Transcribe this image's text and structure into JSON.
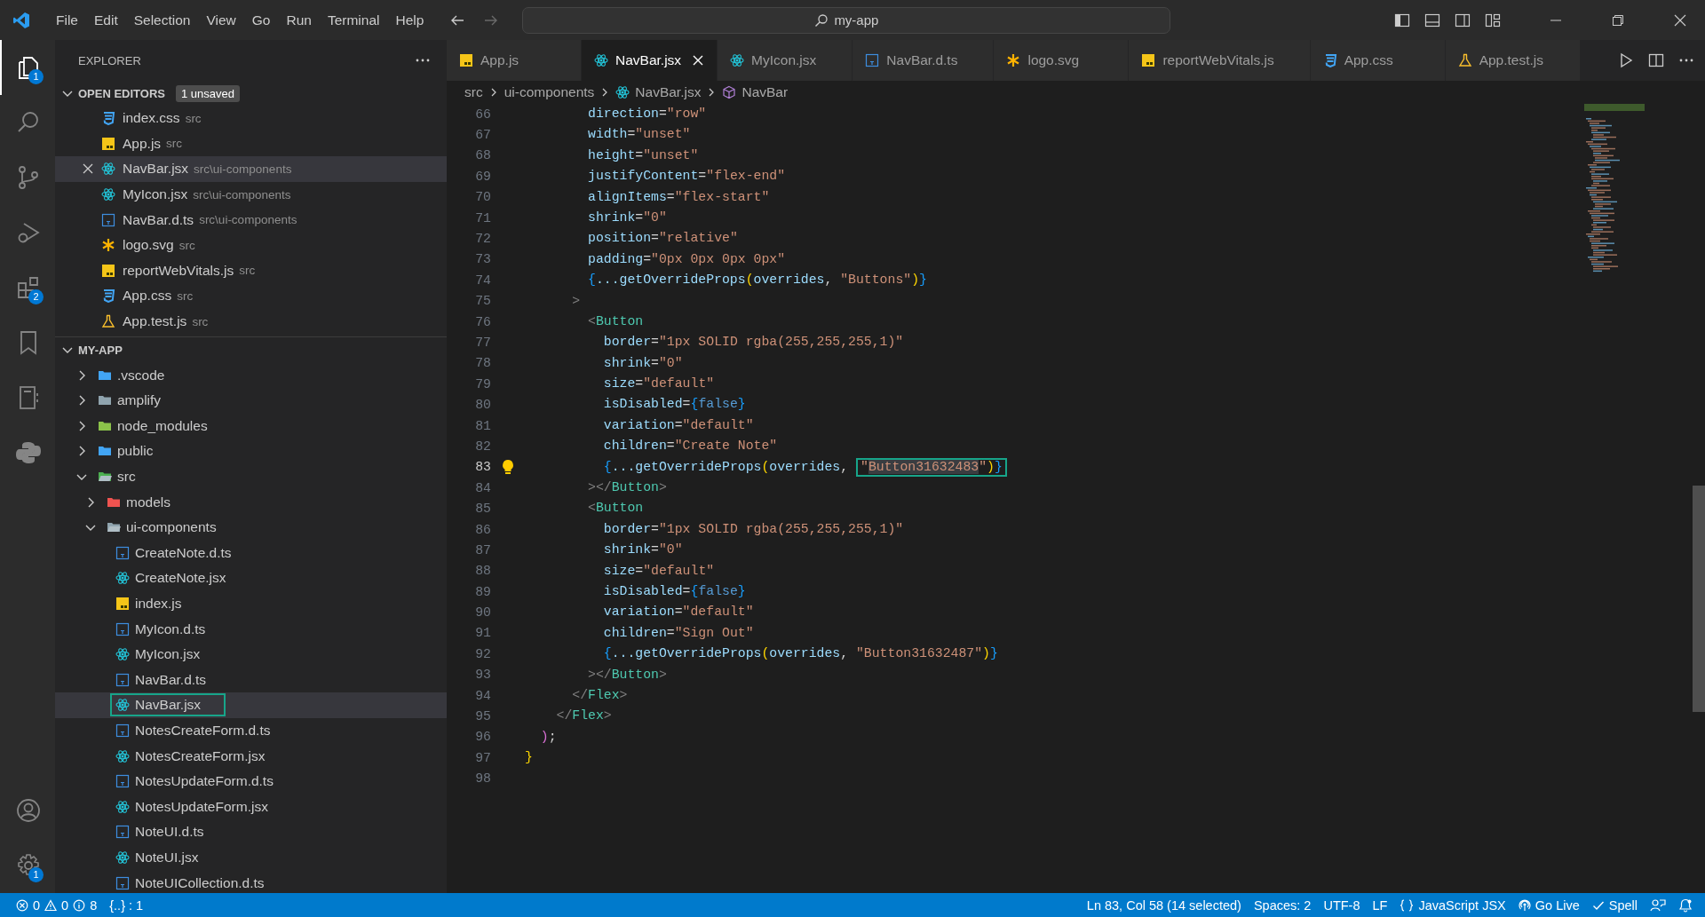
{
  "title_bar": {
    "menu": [
      "File",
      "Edit",
      "Selection",
      "View",
      "Go",
      "Run",
      "Terminal",
      "Help"
    ],
    "search": "my-app"
  },
  "activity_bar": {
    "items": [
      {
        "kind": "files",
        "badge": "1",
        "selected": true
      },
      {
        "kind": "search",
        "selected": false
      },
      {
        "kind": "source-control",
        "selected": false
      },
      {
        "kind": "run",
        "selected": false
      },
      {
        "kind": "extensions",
        "badge": "2",
        "selected": false
      },
      {
        "kind": "bookmark",
        "selected": false
      },
      {
        "kind": "notebook",
        "selected": false
      },
      {
        "kind": "python",
        "selected": false
      }
    ],
    "bottom": [
      {
        "kind": "account"
      },
      {
        "kind": "gear",
        "badge": "1"
      }
    ]
  },
  "sidebar": {
    "title": "EXPLORER",
    "open_editors": {
      "title": "OPEN EDITORS",
      "expanded": true,
      "badge": "1 unsaved",
      "items": [
        {
          "kind": "css",
          "name": "index.css",
          "path": "src",
          "selected": false
        },
        {
          "kind": "js",
          "name": "App.js",
          "path": "src",
          "selected": false
        },
        {
          "kind": "react",
          "name": "NavBar.jsx",
          "path": "src\\ui-components",
          "selected": true
        },
        {
          "kind": "react",
          "name": "MyIcon.jsx",
          "path": "src\\ui-components",
          "selected": false
        },
        {
          "kind": "ts",
          "name": "NavBar.d.ts",
          "path": "src\\ui-components",
          "selected": false
        },
        {
          "kind": "svg",
          "name": "logo.svg",
          "path": "src",
          "selected": false
        },
        {
          "kind": "js",
          "name": "reportWebVitals.js",
          "path": "src",
          "selected": false
        },
        {
          "kind": "css",
          "name": "App.css",
          "path": "src",
          "selected": false
        },
        {
          "kind": "test",
          "name": "App.test.js",
          "path": "src",
          "selected": false
        }
      ]
    },
    "project": {
      "title": "MY-APP",
      "expanded": true,
      "tree": [
        {
          "kind": "folder-vscode",
          "name": ".vscode",
          "expanded": false,
          "selected": false
        },
        {
          "kind": "folder",
          "name": "amplify",
          "expanded": false,
          "selected": false
        },
        {
          "kind": "folder-node",
          "name": "node_modules",
          "expanded": false,
          "selected": false
        },
        {
          "kind": "folder-public",
          "name": "public",
          "expanded": false,
          "selected": false
        },
        {
          "kind": "folder-src",
          "name": "src",
          "expanded": true,
          "selected": false,
          "children": [
            {
              "kind": "folder-models",
              "name": "models",
              "expanded": false,
              "selected": false
            },
            {
              "kind": "folder",
              "name": "ui-components",
              "expanded": true,
              "selected": false,
              "children": [
                {
                  "kind": "ts",
                  "name": "CreateNote.d.ts",
                  "selected": false
                },
                {
                  "kind": "react",
                  "name": "CreateNote.jsx",
                  "selected": false
                },
                {
                  "kind": "js",
                  "name": "index.js",
                  "selected": false
                },
                {
                  "kind": "ts",
                  "name": "MyIcon.d.ts",
                  "selected": false
                },
                {
                  "kind": "react",
                  "name": "MyIcon.jsx",
                  "selected": false
                },
                {
                  "kind": "ts",
                  "name": "NavBar.d.ts",
                  "selected": false
                },
                {
                  "kind": "react",
                  "name": "NavBar.jsx",
                  "selected": true
                },
                {
                  "kind": "ts",
                  "name": "NotesCreateForm.d.ts",
                  "selected": false
                },
                {
                  "kind": "react",
                  "name": "NotesCreateForm.jsx",
                  "selected": false
                },
                {
                  "kind": "ts",
                  "name": "NotesUpdateForm.d.ts",
                  "selected": false
                },
                {
                  "kind": "react",
                  "name": "NotesUpdateForm.jsx",
                  "selected": false
                },
                {
                  "kind": "ts",
                  "name": "NoteUI.d.ts",
                  "selected": false
                },
                {
                  "kind": "react",
                  "name": "NoteUI.jsx",
                  "selected": false
                },
                {
                  "kind": "ts",
                  "name": "NoteUICollection.d.ts",
                  "selected": false
                }
              ]
            }
          ]
        }
      ]
    }
  },
  "tabs": [
    {
      "kind": "js",
      "label": "App.js",
      "selected": false
    },
    {
      "kind": "react",
      "label": "NavBar.jsx",
      "selected": true
    },
    {
      "kind": "react",
      "label": "MyIcon.jsx",
      "selected": false
    },
    {
      "kind": "ts",
      "label": "NavBar.d.ts",
      "selected": false
    },
    {
      "kind": "svg",
      "label": "logo.svg",
      "selected": false
    },
    {
      "kind": "js",
      "label": "reportWebVitals.js",
      "selected": false
    },
    {
      "kind": "css",
      "label": "App.css",
      "selected": false
    },
    {
      "kind": "test",
      "label": "App.test.js",
      "selected": false
    }
  ],
  "breadcrumbs": [
    {
      "kind": "folder",
      "label": "src"
    },
    {
      "kind": "folder",
      "label": "ui-components"
    },
    {
      "kind": "react",
      "label": "NavBar.jsx"
    },
    {
      "kind": "component",
      "label": "NavBar"
    }
  ],
  "editor": {
    "lines": [
      {
        "number": "66",
        "current": false,
        "tokens": [
          {
            "kind": "attr",
            "text": "        direction"
          },
          {
            "kind": "op",
            "text": "="
          },
          {
            "kind": "str",
            "text": "\"row\""
          }
        ]
      },
      {
        "number": "67",
        "current": false,
        "tokens": [
          {
            "kind": "attr",
            "text": "        width"
          },
          {
            "kind": "op",
            "text": "="
          },
          {
            "kind": "str",
            "text": "\"unset\""
          }
        ]
      },
      {
        "number": "68",
        "current": false,
        "tokens": [
          {
            "kind": "attr",
            "text": "        height"
          },
          {
            "kind": "op",
            "text": "="
          },
          {
            "kind": "str",
            "text": "\"unset\""
          }
        ]
      },
      {
        "number": "69",
        "current": false,
        "tokens": [
          {
            "kind": "attr",
            "text": "        justifyContent"
          },
          {
            "kind": "op",
            "text": "="
          },
          {
            "kind": "str",
            "text": "\"flex-end\""
          }
        ]
      },
      {
        "number": "70",
        "current": false,
        "tokens": [
          {
            "kind": "attr",
            "text": "        alignItems"
          },
          {
            "kind": "op",
            "text": "="
          },
          {
            "kind": "str",
            "text": "\"flex-start\""
          }
        ]
      },
      {
        "number": "71",
        "current": false,
        "tokens": [
          {
            "kind": "attr",
            "text": "        shrink"
          },
          {
            "kind": "op",
            "text": "="
          },
          {
            "kind": "str",
            "text": "\"0\""
          }
        ]
      },
      {
        "number": "72",
        "current": false,
        "tokens": [
          {
            "kind": "attr",
            "text": "        position"
          },
          {
            "kind": "op",
            "text": "="
          },
          {
            "kind": "str",
            "text": "\"relative\""
          }
        ]
      },
      {
        "number": "73",
        "current": false,
        "tokens": [
          {
            "kind": "attr",
            "text": "        padding"
          },
          {
            "kind": "op",
            "text": "="
          },
          {
            "kind": "str",
            "text": "\"0px 0px 0px 0px\""
          }
        ]
      },
      {
        "number": "74",
        "current": false,
        "tokens": [
          {
            "kind": "b3",
            "text": "        {"
          },
          {
            "kind": "attr",
            "text": "...getOverrideProps"
          },
          {
            "kind": "b1",
            "text": "("
          },
          {
            "kind": "attr",
            "text": "overrides"
          },
          {
            "kind": "op",
            "text": ", "
          },
          {
            "kind": "str",
            "text": "\"Buttons\""
          },
          {
            "kind": "b1",
            "text": ")"
          },
          {
            "kind": "b3",
            "text": "}"
          }
        ]
      },
      {
        "number": "75",
        "current": false,
        "tokens": [
          {
            "kind": "punc",
            "text": "      >"
          }
        ]
      },
      {
        "number": "76",
        "current": false,
        "tokens": [
          {
            "kind": "punc",
            "text": "        <"
          },
          {
            "kind": "tag",
            "text": "Button"
          }
        ]
      },
      {
        "number": "77",
        "current": false,
        "tokens": [
          {
            "kind": "attr",
            "text": "          border"
          },
          {
            "kind": "op",
            "text": "="
          },
          {
            "kind": "str",
            "text": "\"1px SOLID rgba(255,255,255,1)\""
          }
        ]
      },
      {
        "number": "78",
        "current": false,
        "tokens": [
          {
            "kind": "attr",
            "text": "          shrink"
          },
          {
            "kind": "op",
            "text": "="
          },
          {
            "kind": "str",
            "text": "\"0\""
          }
        ]
      },
      {
        "number": "79",
        "current": false,
        "tokens": [
          {
            "kind": "attr",
            "text": "          size"
          },
          {
            "kind": "op",
            "text": "="
          },
          {
            "kind": "str",
            "text": "\"default\""
          }
        ]
      },
      {
        "number": "80",
        "current": false,
        "tokens": [
          {
            "kind": "attr",
            "text": "          isDisabled"
          },
          {
            "kind": "op",
            "text": "="
          },
          {
            "kind": "b3",
            "text": "{"
          },
          {
            "kind": "kw",
            "text": "false"
          },
          {
            "kind": "b3",
            "text": "}"
          }
        ]
      },
      {
        "number": "81",
        "current": false,
        "tokens": [
          {
            "kind": "attr",
            "text": "          variation"
          },
          {
            "kind": "op",
            "text": "="
          },
          {
            "kind": "str",
            "text": "\"default\""
          }
        ]
      },
      {
        "number": "82",
        "current": false,
        "tokens": [
          {
            "kind": "attr",
            "text": "          children"
          },
          {
            "kind": "op",
            "text": "="
          },
          {
            "kind": "str",
            "text": "\"Create Note\""
          }
        ]
      },
      {
        "number": "83",
        "current": true,
        "tokens": [
          {
            "kind": "b3",
            "text": "          {"
          },
          {
            "kind": "attr",
            "text": "...getOverrideProps"
          },
          {
            "kind": "b1",
            "text": "("
          },
          {
            "kind": "attr",
            "text": "overrides"
          },
          {
            "kind": "op",
            "text": ", "
          },
          {
            "kind": "box",
            "parts": [
              {
                "kind": "str",
                "text": "\""
              },
              {
                "kind": "sel",
                "text": "Button31632483"
              },
              {
                "kind": "str",
                "text": "\""
              },
              {
                "kind": "b1",
                "text": ")"
              },
              {
                "kind": "b3",
                "text": "}"
              }
            ]
          }
        ]
      },
      {
        "number": "84",
        "current": false,
        "tokens": [
          {
            "kind": "punc",
            "text": "        ></"
          },
          {
            "kind": "tag",
            "text": "Button"
          },
          {
            "kind": "punc",
            "text": ">"
          }
        ]
      },
      {
        "number": "85",
        "current": false,
        "tokens": [
          {
            "kind": "punc",
            "text": "        <"
          },
          {
            "kind": "tag",
            "text": "Button"
          }
        ]
      },
      {
        "number": "86",
        "current": false,
        "tokens": [
          {
            "kind": "attr",
            "text": "          border"
          },
          {
            "kind": "op",
            "text": "="
          },
          {
            "kind": "str",
            "text": "\"1px SOLID rgba(255,255,255,1)\""
          }
        ]
      },
      {
        "number": "87",
        "current": false,
        "tokens": [
          {
            "kind": "attr",
            "text": "          shrink"
          },
          {
            "kind": "op",
            "text": "="
          },
          {
            "kind": "str",
            "text": "\"0\""
          }
        ]
      },
      {
        "number": "88",
        "current": false,
        "tokens": [
          {
            "kind": "attr",
            "text": "          size"
          },
          {
            "kind": "op",
            "text": "="
          },
          {
            "kind": "str",
            "text": "\"default\""
          }
        ]
      },
      {
        "number": "89",
        "current": false,
        "tokens": [
          {
            "kind": "attr",
            "text": "          isDisabled"
          },
          {
            "kind": "op",
            "text": "="
          },
          {
            "kind": "b3",
            "text": "{"
          },
          {
            "kind": "kw",
            "text": "false"
          },
          {
            "kind": "b3",
            "text": "}"
          }
        ]
      },
      {
        "number": "90",
        "current": false,
        "tokens": [
          {
            "kind": "attr",
            "text": "          variation"
          },
          {
            "kind": "op",
            "text": "="
          },
          {
            "kind": "str",
            "text": "\"default\""
          }
        ]
      },
      {
        "number": "91",
        "current": false,
        "tokens": [
          {
            "kind": "attr",
            "text": "          children"
          },
          {
            "kind": "op",
            "text": "="
          },
          {
            "kind": "str",
            "text": "\"Sign Out\""
          }
        ]
      },
      {
        "number": "92",
        "current": false,
        "tokens": [
          {
            "kind": "b3",
            "text": "          {"
          },
          {
            "kind": "attr",
            "text": "...getOverrideProps"
          },
          {
            "kind": "b1",
            "text": "("
          },
          {
            "kind": "attr",
            "text": "overrides"
          },
          {
            "kind": "op",
            "text": ", "
          },
          {
            "kind": "str",
            "text": "\"Button31632487\""
          },
          {
            "kind": "b1",
            "text": ")"
          },
          {
            "kind": "b3",
            "text": "}"
          }
        ]
      },
      {
        "number": "93",
        "current": false,
        "tokens": [
          {
            "kind": "punc",
            "text": "        ></"
          },
          {
            "kind": "tag",
            "text": "Button"
          },
          {
            "kind": "punc",
            "text": ">"
          }
        ]
      },
      {
        "number": "94",
        "current": false,
        "tokens": [
          {
            "kind": "punc",
            "text": "      </"
          },
          {
            "kind": "tag",
            "text": "Flex"
          },
          {
            "kind": "punc",
            "text": ">"
          }
        ]
      },
      {
        "number": "95",
        "current": false,
        "tokens": [
          {
            "kind": "punc",
            "text": "    </"
          },
          {
            "kind": "tag",
            "text": "Flex"
          },
          {
            "kind": "punc",
            "text": ">"
          }
        ]
      },
      {
        "number": "96",
        "current": false,
        "tokens": [
          {
            "kind": "b2",
            "text": "  )"
          },
          {
            "kind": "op",
            "text": ";"
          }
        ]
      },
      {
        "number": "97",
        "current": false,
        "tokens": [
          {
            "kind": "b1",
            "text": "}"
          }
        ]
      },
      {
        "number": "98",
        "current": false
      }
    ]
  },
  "status_bar": {
    "errors": "0",
    "warnings": "0",
    "infos": "8",
    "brackets": "{..} : 1",
    "position": "Ln 83, Col 58 (14 selected)",
    "spaces": "Spaces: 2",
    "encoding": "UTF-8",
    "eol": "LF",
    "language": "JavaScript JSX",
    "live": "Go Live",
    "spell": "Spell"
  }
}
